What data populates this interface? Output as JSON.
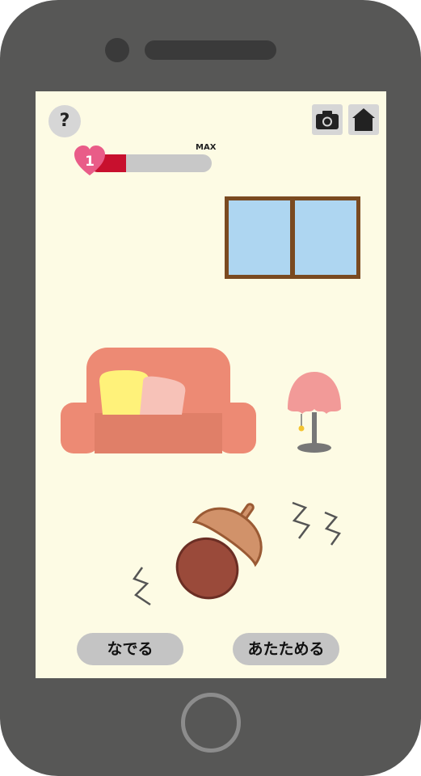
{
  "header": {
    "help_label": "?",
    "camera_icon": "camera-icon",
    "home_icon": "home-icon"
  },
  "affection": {
    "level": "1",
    "max_label": "MAX",
    "fill_fraction": 0.3,
    "colors": {
      "fill": "#c8102e",
      "track": "#c8c8c8",
      "heart": "#e95c88"
    }
  },
  "scene": {
    "background": "#fdfbe4",
    "items": [
      "window",
      "sofa",
      "lamp",
      "acorn",
      "zzz-marks"
    ]
  },
  "actions": {
    "pet_label": "なでる",
    "warm_label": "あたためる"
  }
}
